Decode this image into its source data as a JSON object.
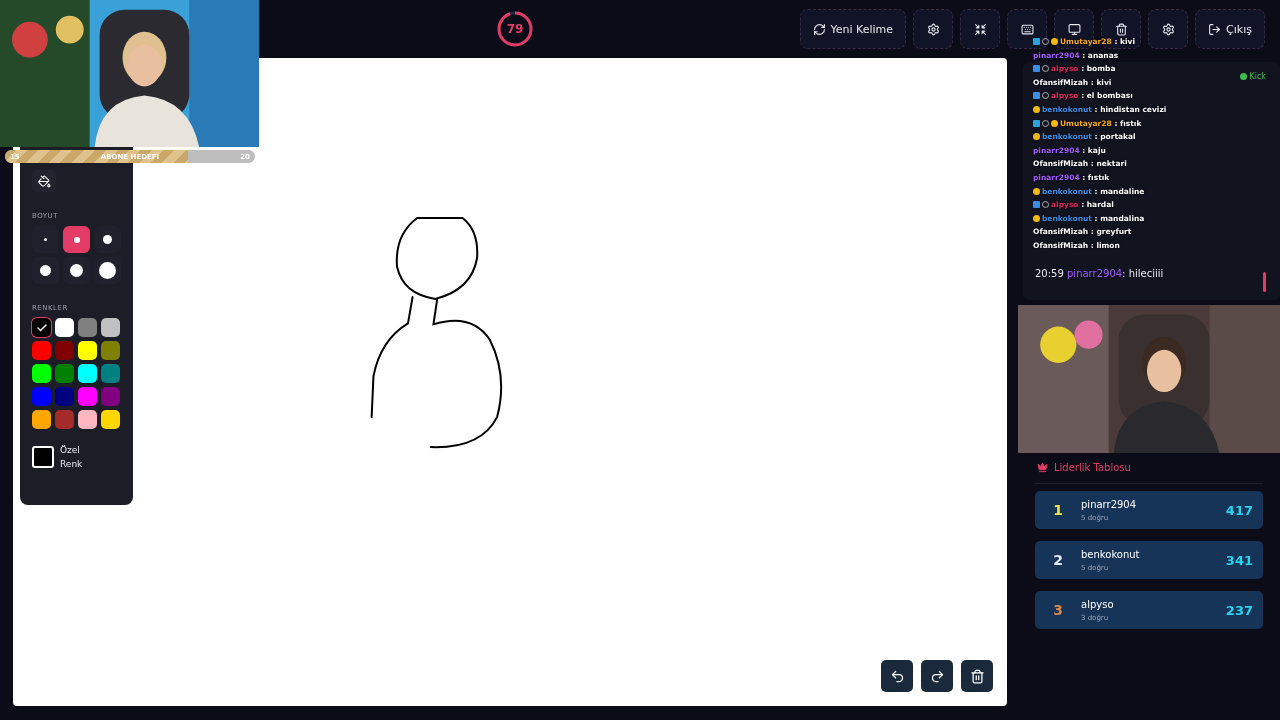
{
  "timer": {
    "value": "79",
    "level": 0.95
  },
  "toolbar": [
    {
      "kind": "refresh",
      "label": "Yeni Kelime"
    },
    {
      "kind": "gear"
    },
    {
      "kind": "compress"
    },
    {
      "kind": "keyboard"
    },
    {
      "kind": "monitor"
    },
    {
      "kind": "trash"
    },
    {
      "kind": "gear"
    },
    {
      "kind": "exit",
      "label": "Çıkış"
    }
  ],
  "goal": {
    "start": "15",
    "label": "ABONE HEDEFİ",
    "end": "20",
    "level": 0.73
  },
  "tools": {
    "size_label": "BOYUT",
    "sizes": [
      {
        "selected": false
      },
      {
        "selected": true
      },
      {
        "selected": false
      },
      {
        "selected": false
      },
      {
        "selected": false
      },
      {
        "selected": false
      }
    ],
    "colors_label": "RENKLER",
    "colors": [
      {
        "color": "#000000",
        "selected": true
      },
      {
        "color": "#ffffff",
        "selected": false
      },
      {
        "color": "#808080",
        "selected": false
      },
      {
        "color": "#c0c0c0",
        "selected": false
      },
      {
        "color": "#ff0000",
        "selected": false
      },
      {
        "color": "#800000",
        "selected": false
      },
      {
        "color": "#ffff00",
        "selected": false
      },
      {
        "color": "#808000",
        "selected": false
      },
      {
        "color": "#00ff00",
        "selected": false
      },
      {
        "color": "#008000",
        "selected": false
      },
      {
        "color": "#00ffff",
        "selected": false
      },
      {
        "color": "#008080",
        "selected": false
      },
      {
        "color": "#0000ff",
        "selected": false
      },
      {
        "color": "#000080",
        "selected": false
      },
      {
        "color": "#ff00ff",
        "selected": false
      },
      {
        "color": "#800080",
        "selected": false
      },
      {
        "color": "#ffa500",
        "selected": false
      },
      {
        "color": "#a52a2a",
        "selected": false
      },
      {
        "color": "#ffb6c1",
        "selected": false
      },
      {
        "color": "#ffd700",
        "selected": false
      }
    ],
    "custom": {
      "label": "Özel Renk",
      "color": "#000000"
    }
  },
  "canvas_actions": [
    {
      "kind": "undo"
    },
    {
      "kind": "redo"
    },
    {
      "kind": "trash"
    }
  ],
  "chat": {
    "badge": "Kick",
    "messages": [
      {
        "time": "20:59",
        "user": "pinarr2904",
        "text": ": hileciiii",
        "color": "#a259ff"
      }
    ]
  },
  "stream_chat": [
    {
      "user": "Umutayar28",
      "text": ": kivi",
      "color": "#f5a623",
      "kind": "subscriber"
    },
    {
      "user": "pinarr2904",
      "text": ": ananas",
      "color": "#a259ff",
      "kind": "plain"
    },
    {
      "user": "alpyso",
      "text": ": bomba",
      "color": "#e0245e",
      "kind": "vip"
    },
    {
      "user": "OfansifMizah",
      "text": ": kivi",
      "color": "#ffffff",
      "kind": "plain"
    },
    {
      "user": "alpyso",
      "text": ": el bombası",
      "color": "#e0245e",
      "kind": "vip"
    },
    {
      "user": "benkokonut",
      "text": ": hindistan cevizi",
      "color": "#3a8ee6",
      "kind": "supporter"
    },
    {
      "user": "Umutayar28",
      "text": ": fıstık",
      "color": "#f5a623",
      "kind": "subscriber"
    },
    {
      "user": "benkokonut",
      "text": ": portakal",
      "color": "#3a8ee6",
      "kind": "supporter"
    },
    {
      "user": "pinarr2904",
      "text": ": kaju",
      "color": "#a259ff",
      "kind": "plain"
    },
    {
      "user": "OfansifMizah",
      "text": ": nektari",
      "color": "#ffffff",
      "kind": "plain"
    },
    {
      "user": "pinarr2904",
      "text": ": fıstık",
      "color": "#a259ff",
      "kind": "plain"
    },
    {
      "user": "benkokonut",
      "text": ": mandaline",
      "color": "#3a8ee6",
      "kind": "supporter"
    },
    {
      "user": "alpyso",
      "text": ": hardal",
      "color": "#e0245e",
      "kind": "vip"
    },
    {
      "user": "benkokonut",
      "text": ": mandalina",
      "color": "#3a8ee6",
      "kind": "supporter"
    },
    {
      "user": "OfansifMizah",
      "text": ": greyfurt",
      "color": "#ffffff",
      "kind": "plain"
    },
    {
      "user": "OfansifMizah",
      "text": ": limon",
      "color": "#ffffff",
      "kind": "plain"
    }
  ],
  "leaderboard": {
    "title": "Liderlik Tablosu",
    "entries": [
      {
        "rank": "1",
        "name": "pinarr2904",
        "detail": "5 doğru",
        "score": "417",
        "color": "#f2e84a"
      },
      {
        "rank": "2",
        "name": "benkokonut",
        "detail": "5 doğru",
        "score": "341",
        "color": "#e6e9f0"
      },
      {
        "rank": "3",
        "name": "alpyso",
        "detail": "3 doğru",
        "score": "237",
        "color": "#d9894a"
      }
    ]
  }
}
